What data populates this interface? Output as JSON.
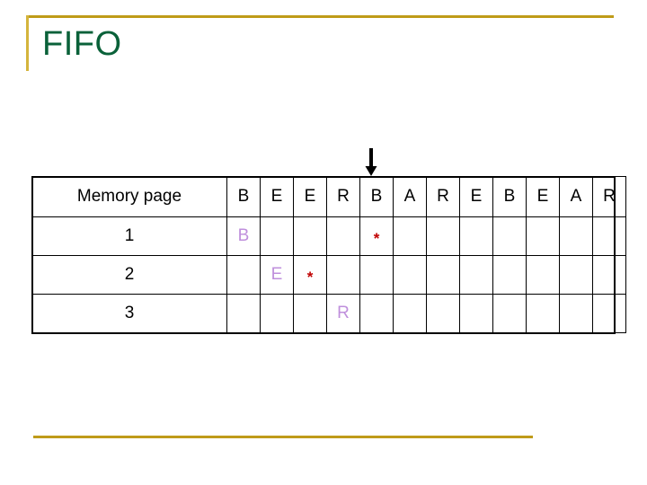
{
  "slide": {
    "title": "FIFO",
    "title_color": "#0a6139",
    "rule_color": "#bf9b19",
    "background": "#ffffff"
  },
  "arrow": {
    "icon": "arrow-down-icon",
    "color": "#000000",
    "points_to_column_index": 0
  },
  "table": {
    "label_header": "Memory page",
    "reference_string": [
      "B",
      "E",
      "E",
      "R",
      "B",
      "A",
      "R",
      "E",
      "B",
      "E",
      "A",
      "R"
    ],
    "letter_color": "#bf8fdc",
    "star_color": "#c00000",
    "rows": [
      {
        "label": "1",
        "cells": [
          "B",
          "",
          "",
          "",
          "*",
          "",
          "",
          "",
          "",
          "",
          "",
          ""
        ]
      },
      {
        "label": "2",
        "cells": [
          "",
          "E",
          "*",
          "",
          "",
          "",
          "",
          "",
          "",
          "",
          "",
          ""
        ]
      },
      {
        "label": "3",
        "cells": [
          "",
          "",
          "",
          "R",
          "",
          "",
          "",
          "",
          "",
          "",
          "",
          ""
        ]
      }
    ]
  }
}
